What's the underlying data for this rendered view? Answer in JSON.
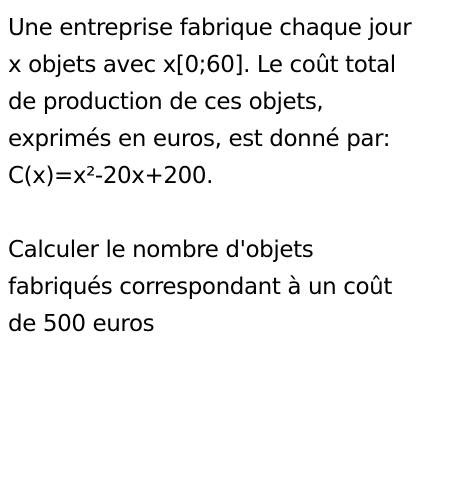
{
  "problem": {
    "statement_lines": [
      "Une entreprise fabrique chaque jour",
      "x objets avec x[0;60]. Le coût total",
      "de production de ces objets,",
      "exprimés en euros, est donné par:",
      "C(x)=x²-20x+200."
    ],
    "question_lines": [
      "Calculer le nombre d'objets",
      "fabriqués correspondant à un coût",
      "de 500 euros"
    ]
  }
}
